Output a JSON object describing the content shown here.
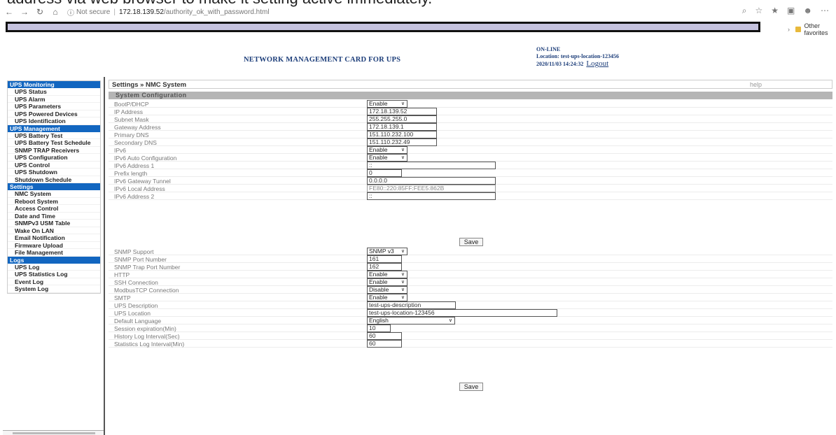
{
  "caption": "address via web browser to make it  setting active immediately.",
  "browser": {
    "not_secure": "Not secure",
    "host": "172.18.139.52",
    "path": "/authority_ok_with_password.html",
    "other_favorites": "Other favorites"
  },
  "header": {
    "title": "NETWORK MANAGEMENT CARD FOR UPS",
    "status": "ON-LINE",
    "location": "Location: test-ups-location-123456",
    "datetime": "2020/11/03 14:24:32",
    "logout": "Logout"
  },
  "sidebar": {
    "groups": [
      {
        "title": "UPS Monitoring",
        "items": [
          "UPS Status",
          "UPS Alarm",
          "UPS Parameters",
          "UPS Powered Devices",
          "UPS Identification"
        ]
      },
      {
        "title": "UPS Management",
        "items": [
          "UPS Battery Test",
          "UPS Battery Test Schedule",
          "SNMP TRAP Receivers",
          "UPS Configuration",
          "UPS Control",
          "UPS Shutdown",
          "Shutdown Schedule"
        ]
      },
      {
        "title": "Settings",
        "items": [
          "NMC System",
          "Reboot System",
          "Access Control",
          "Date and Time",
          "SNMPv3 USM Table",
          "Wake On LAN",
          "Email Notification",
          "Firmware Upload",
          "File Management"
        ]
      },
      {
        "title": "Logs",
        "items": [
          "UPS Log",
          "UPS Statistics Log",
          "Event Log",
          "System Log"
        ]
      }
    ]
  },
  "main": {
    "breadcrumb": "Settings » NMC System",
    "help": "help",
    "section_title": "System Configuration",
    "save_label": "Save",
    "network_rows": [
      {
        "label": "BootP/DHCP",
        "type": "select",
        "value": "Enable"
      },
      {
        "label": "IP Address",
        "type": "input",
        "value": "172.18.139.52"
      },
      {
        "label": "Subnet Mask",
        "type": "input",
        "value": "255.255.255.0"
      },
      {
        "label": "Gateway Address",
        "type": "input",
        "value": "172.18.139.1"
      },
      {
        "label": "Primary DNS",
        "type": "input",
        "value": "151.110.232.100"
      },
      {
        "label": "Secondary DNS",
        "type": "input",
        "value": "151.110.232.49"
      },
      {
        "label": "IPv6",
        "type": "select",
        "value": "Enable"
      },
      {
        "label": "IPv6 Auto Configuration",
        "type": "select",
        "value": "Enable"
      },
      {
        "label": "IPv6 Address 1",
        "type": "input-wide",
        "value": "::"
      },
      {
        "label": "Prefix length",
        "type": "input-small",
        "value": "0"
      },
      {
        "label": "IPv6 Gateway Tunnel",
        "type": "input-wide",
        "value": "0.0.0.0"
      },
      {
        "label": "IPv6 Local Address",
        "type": "input-wide-ro",
        "value": "FE80::220:85FF:FEE5:862B"
      },
      {
        "label": "IPv6 Address 2",
        "type": "input-wide",
        "value": "::"
      }
    ],
    "service_rows": [
      {
        "label": "SNMP Support",
        "type": "select",
        "value": "SNMP v3"
      },
      {
        "label": "SNMP Port Number",
        "type": "input-small",
        "value": "161"
      },
      {
        "label": "SNMP Trap Port Number",
        "type": "input-small",
        "value": "162"
      },
      {
        "label": "HTTP",
        "type": "select",
        "value": "Enable"
      },
      {
        "label": "SSH Connection",
        "type": "select",
        "value": "Enable"
      },
      {
        "label": "ModbusTCP Connection",
        "type": "select",
        "value": "Disable"
      },
      {
        "label": "SMTP",
        "type": "select",
        "value": "Enable"
      },
      {
        "label": "UPS Description",
        "type": "input-mid",
        "value": "test-ups-description"
      },
      {
        "label": "UPS Location",
        "type": "input-long",
        "value": "test-ups-location-123456"
      },
      {
        "label": "Default Language",
        "type": "select-wide",
        "value": "English"
      },
      {
        "label": "Session expiration(Min)",
        "type": "input-tiny",
        "value": "10"
      },
      {
        "label": "History Log Interval(Sec)",
        "type": "input-small",
        "value": "60"
      },
      {
        "label": "Statistics Log Interval(Min)",
        "type": "input-small",
        "value": "60"
      }
    ]
  }
}
